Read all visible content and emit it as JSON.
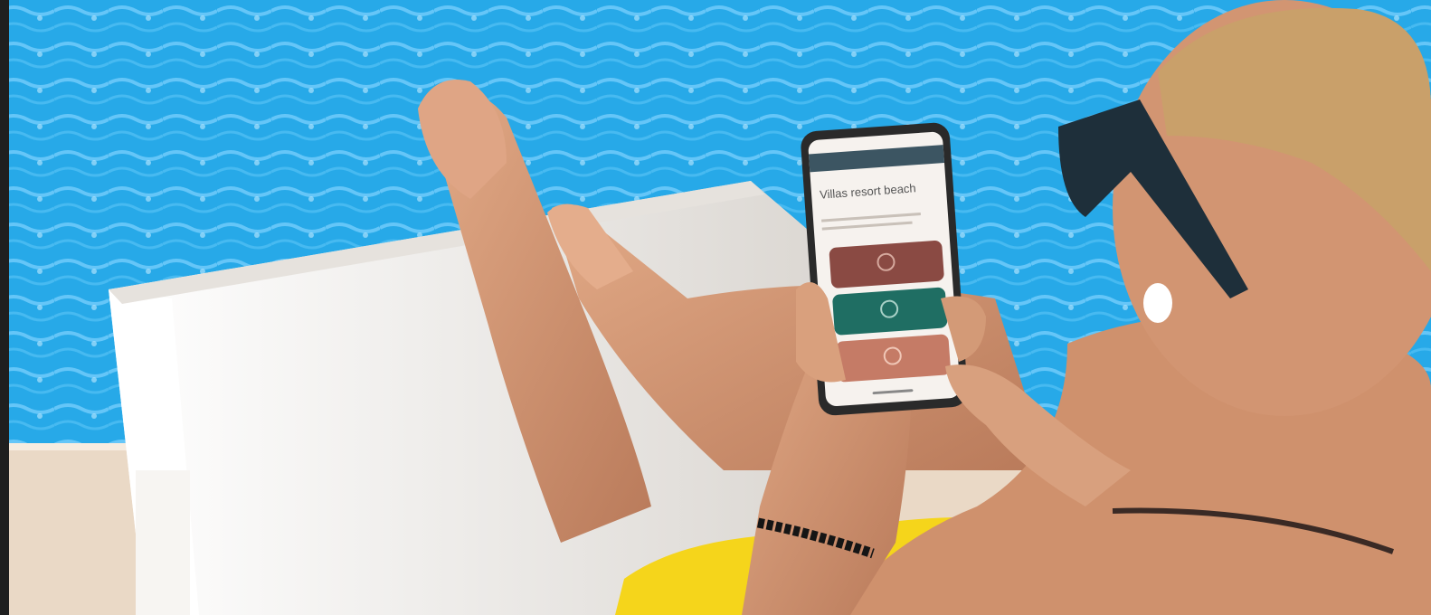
{
  "photo": {
    "colors": {
      "pool": "#27a9e8",
      "pool_light": "#7fd3ff",
      "lounger": "#f3f1ee",
      "skin": "#d49a78",
      "skin_shadow": "#b97a5a",
      "shorts": "#f5d51b",
      "hair": "#c9a06a",
      "sunglasses": "#1e2f3a",
      "phone_body": "#2a2a2a",
      "card_1": "#8a4a43",
      "card_2": "#1f6e63",
      "card_3": "#c57b66"
    },
    "phone_screen": {
      "title": "Villas resort beach"
    }
  }
}
